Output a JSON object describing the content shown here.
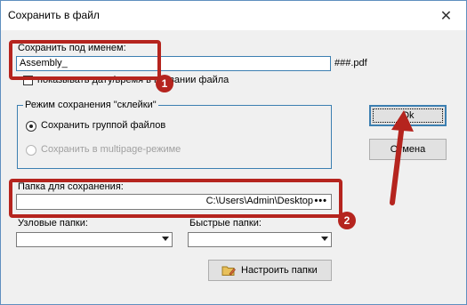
{
  "window": {
    "title": "Сохранить в файл",
    "close_symbol": "✕"
  },
  "save_name": {
    "label": "Сохранить под именем:",
    "value": "Assembly_",
    "suffix": "###.pdf",
    "show_datetime_label": "показывать дату/время в названии файла"
  },
  "glue_mode": {
    "title": "Режим сохранения \"склейки\"",
    "option_group": "Сохранить группой файлов",
    "option_multipage": "Сохранить в multipage-режиме"
  },
  "buttons": {
    "ok": "Ok",
    "cancel": "Отмена",
    "configure_folders": "Настроить папки"
  },
  "save_folder": {
    "label": "Папка для сохранения:",
    "value": "C:\\Users\\Admin\\Desktop",
    "browse": "•••"
  },
  "node_folders": {
    "label": "Узловые папки:"
  },
  "quick_folders": {
    "label": "Быстрые папки:"
  },
  "annotations": {
    "badge1": "1",
    "badge2": "2",
    "color": "#b5241e"
  }
}
